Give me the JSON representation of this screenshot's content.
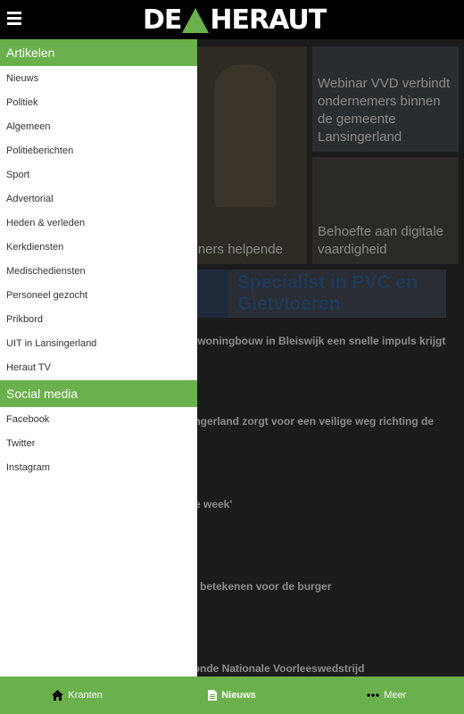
{
  "header": {
    "logo_left": "DE",
    "logo_right": "HERAUT"
  },
  "drawer": {
    "section1_title": "Artikelen",
    "items": [
      "Nieuws",
      "Politiek",
      "Algemeen",
      "Politieberichten",
      "Sport",
      "Advertorial",
      "Heden & verleden",
      "Kerkdiensten",
      "Medischediensten",
      "Personeel gezocht",
      "Prikbord",
      "UIT in Lansingerland",
      "Heraut TV"
    ],
    "section2_title": "Social media",
    "social": [
      "Facebook",
      "Twitter",
      "Instagram"
    ]
  },
  "content": {
    "card_big_caption": "voners helpende",
    "card_tr_caption": "Webinar VVD verbindt ondernemers binnen de gemeente Lansingerland",
    "card_br_caption": "Behoefte aan digitale vaardigheid",
    "banner_text": "Specialist in PVC en Gietvloeren",
    "articles": [
      "dat woningbouw in Bleiswijk een snelle impuls krijgt",
      "nsingerland zorgt voor een veilige weg richting de",
      "n de week'",
      "iets betekenen voor de burger",
      "orronde Nationale Voorleeswedstrijd"
    ]
  },
  "bottom_nav": {
    "tabs": [
      "Kranten",
      "Nieuws",
      "Meer"
    ],
    "active": "Nieuws"
  },
  "colors": {
    "accent": "#6ab04c",
    "header_bg": "#000000"
  }
}
